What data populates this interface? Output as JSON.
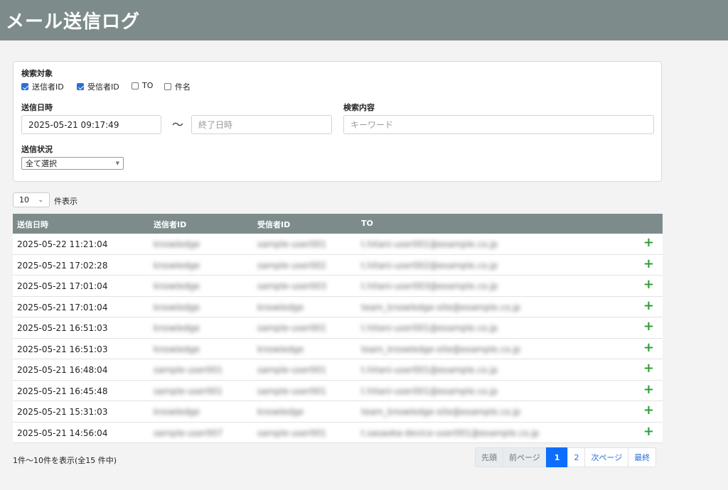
{
  "header": {
    "title": "メール送信ログ"
  },
  "search": {
    "target_label": "検索対象",
    "targets": [
      {
        "label": "送信者ID",
        "checked": true
      },
      {
        "label": "受信者ID",
        "checked": true
      },
      {
        "label": "TO",
        "checked": false
      },
      {
        "label": "件名",
        "checked": false
      }
    ],
    "date_label": "送信日時",
    "date_start_value": "2025-05-21 09:17:49",
    "date_separator": "〜",
    "date_end_placeholder": "終了日時",
    "content_label": "検索内容",
    "content_placeholder": "キーワード",
    "status_label": "送信状況",
    "status_value": "全て選択"
  },
  "length": {
    "value": "10",
    "suffix": "件表示"
  },
  "table": {
    "columns": [
      "送信日時",
      "送信者ID",
      "受信者ID",
      "TO"
    ],
    "rows": [
      {
        "date": "2025-05-22 11:21:04",
        "sender": "knowledge",
        "receiver": "sample-user001",
        "to": "t.hitani-user001@example.co.jp"
      },
      {
        "date": "2025-05-21 17:02:28",
        "sender": "knowledge",
        "receiver": "sample-user002",
        "to": "t.hitani-user002@example.co.jp"
      },
      {
        "date": "2025-05-21 17:01:04",
        "sender": "knowledge",
        "receiver": "sample-user003",
        "to": "t.hitani-user003@example.co.jp"
      },
      {
        "date": "2025-05-21 17:01:04",
        "sender": "knowledge",
        "receiver": "knowledge",
        "to": "team_knowledge-site@example.co.jp"
      },
      {
        "date": "2025-05-21 16:51:03",
        "sender": "knowledge",
        "receiver": "sample-user001",
        "to": "t.hitani-user001@example.co.jp"
      },
      {
        "date": "2025-05-21 16:51:03",
        "sender": "knowledge",
        "receiver": "knowledge",
        "to": "team_knowledge-site@example.co.jp"
      },
      {
        "date": "2025-05-21 16:48:04",
        "sender": "sample-user001",
        "receiver": "sample-user001",
        "to": "t.hitani-user001@example.co.jp"
      },
      {
        "date": "2025-05-21 16:45:48",
        "sender": "sample-user001",
        "receiver": "sample-user001",
        "to": "t.hitani-user001@example.co.jp"
      },
      {
        "date": "2025-05-21 15:31:03",
        "sender": "knowledge",
        "receiver": "knowledge",
        "to": "team_knowledge-site@example.co.jp"
      },
      {
        "date": "2025-05-21 14:56:04",
        "sender": "sample-user007",
        "receiver": "sample-user001",
        "to": "t.sasaoka-device-user001@example.co.jp"
      }
    ],
    "row_action_icon": "plus-icon"
  },
  "info": "1件～10件を表示(全15 件中)",
  "pagination": {
    "first": "先頭",
    "prev": "前ページ",
    "pages": [
      "1",
      "2"
    ],
    "next": "次ページ",
    "last": "最終"
  },
  "colors": {
    "header_bg": "#7d8b8b",
    "active_page": "#0d6efd",
    "plus": "#2e9e3a"
  }
}
